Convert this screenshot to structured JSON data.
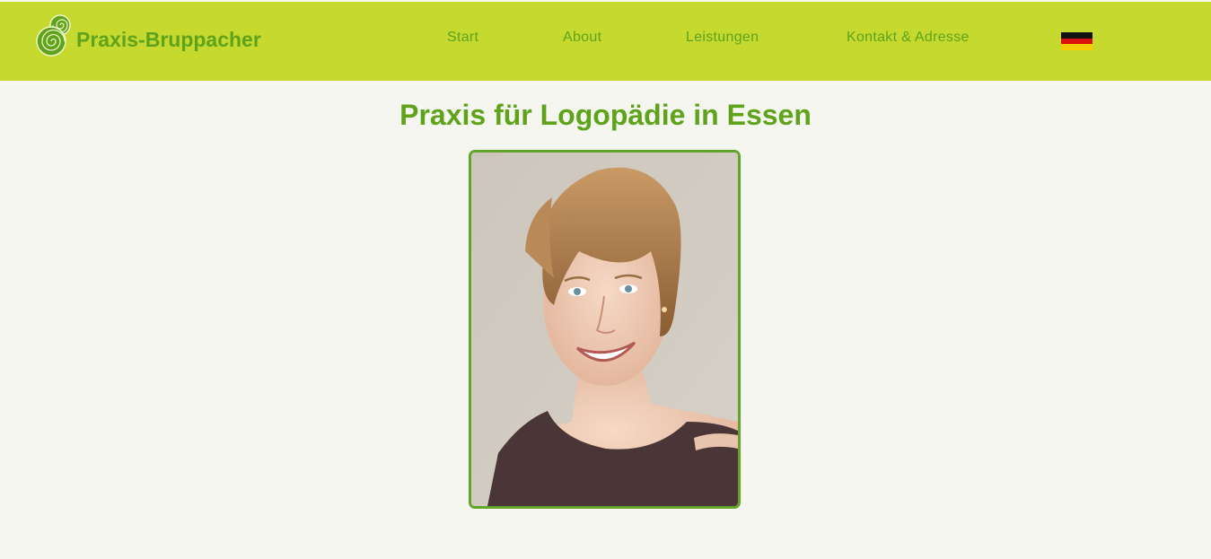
{
  "brand": {
    "name": "Praxis-Bruppacher",
    "logo_icon": "spiral-logo-icon"
  },
  "nav": {
    "items": [
      {
        "label": "Start"
      },
      {
        "label": "About"
      },
      {
        "label": "Leistungen"
      },
      {
        "label": "Kontakt & Adresse"
      }
    ],
    "language_flag": "german-flag-icon"
  },
  "main": {
    "title": "Praxis für Logopädie in Essen",
    "portrait": "portrait-photo"
  },
  "colors": {
    "header_bg": "#c5d92f",
    "brand_green": "#5fa31c",
    "page_bg": "#f5f6ef",
    "frame_green": "#62a52a"
  }
}
